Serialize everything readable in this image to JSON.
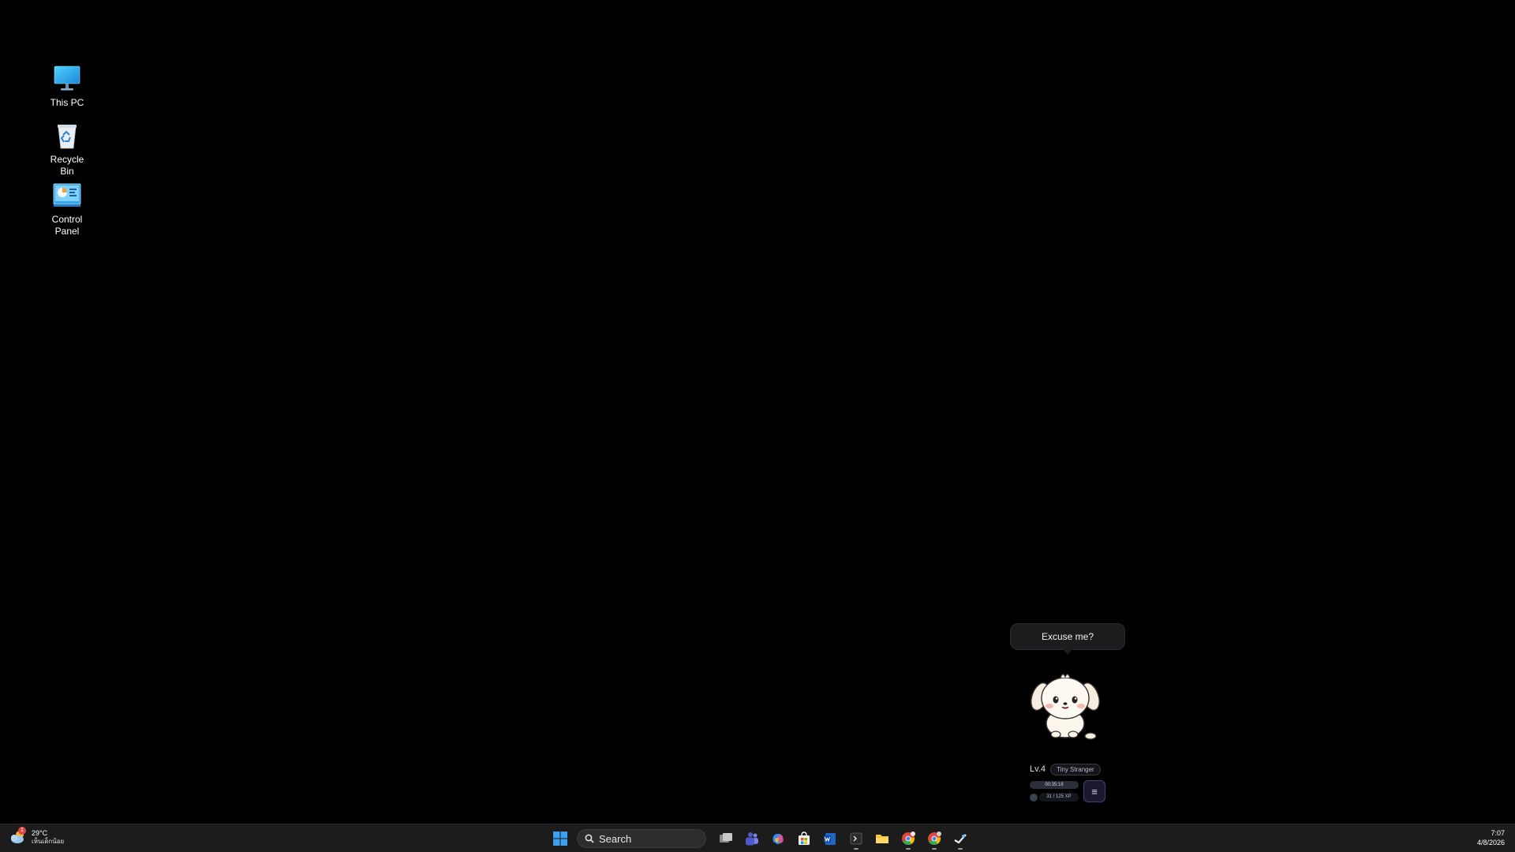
{
  "desktop": {
    "icons": [
      {
        "label": "This PC",
        "icon": "monitor-icon"
      },
      {
        "label": "Recycle Bin",
        "icon": "recycle-bin-icon"
      },
      {
        "label": "Control Panel",
        "icon": "control-panel-icon"
      }
    ]
  },
  "pet": {
    "speech": "Excuse me?",
    "level": "Lv.4",
    "title": "Tiny Stranger",
    "timer": "00:35:18",
    "xp": "31 / 125 XP",
    "menu_icon": "≡"
  },
  "taskbar": {
    "weather": {
      "temp": "29°C",
      "desc": "เห็นเด็กน้อย",
      "badge": "1"
    },
    "search_placeholder": "Search",
    "apps": [
      "start-icon",
      "task-view-icon",
      "teams-icon",
      "copilot-icon",
      "store-icon",
      "edge-word-icon",
      "terminal-icon",
      "file-explorer-icon",
      "chrome-icon",
      "chrome-icon-2",
      "steam-icon"
    ],
    "clock": {
      "time": "7:07",
      "date": "4/8/2026"
    }
  },
  "colors": {
    "taskbar_bg": "#1c1c1c",
    "accent_blue": "#3aa0f0",
    "pet_menu_accent": "#4a3d75"
  }
}
